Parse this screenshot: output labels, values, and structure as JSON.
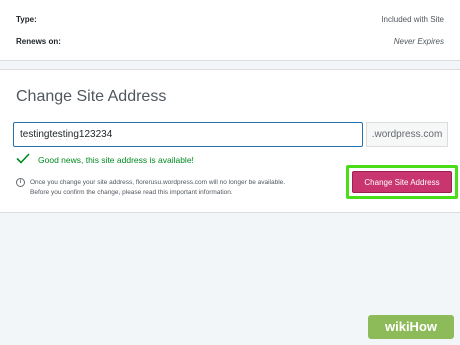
{
  "plan": {
    "type_label": "Type:",
    "type_value": "Included with Site",
    "renews_label": "Renews on:",
    "renews_value": "Never Expires"
  },
  "change_address": {
    "title": "Change Site Address",
    "input_value": "testingtesting123234",
    "suffix": ".wordpress.com",
    "availability_message": "Good news, this site address is available!",
    "info_line1": "Once you change your site address, florerusu.wordpress.com will no longer be available.",
    "info_line2": "Before you confirm the change, please read this important information.",
    "button_label": "Change Site Address"
  },
  "colors": {
    "button": "#c9356e",
    "highlight": "#4ade1a",
    "success": "#008a20",
    "watermark": "#8dbb5a"
  },
  "watermark": {
    "text": "wikiHow"
  }
}
